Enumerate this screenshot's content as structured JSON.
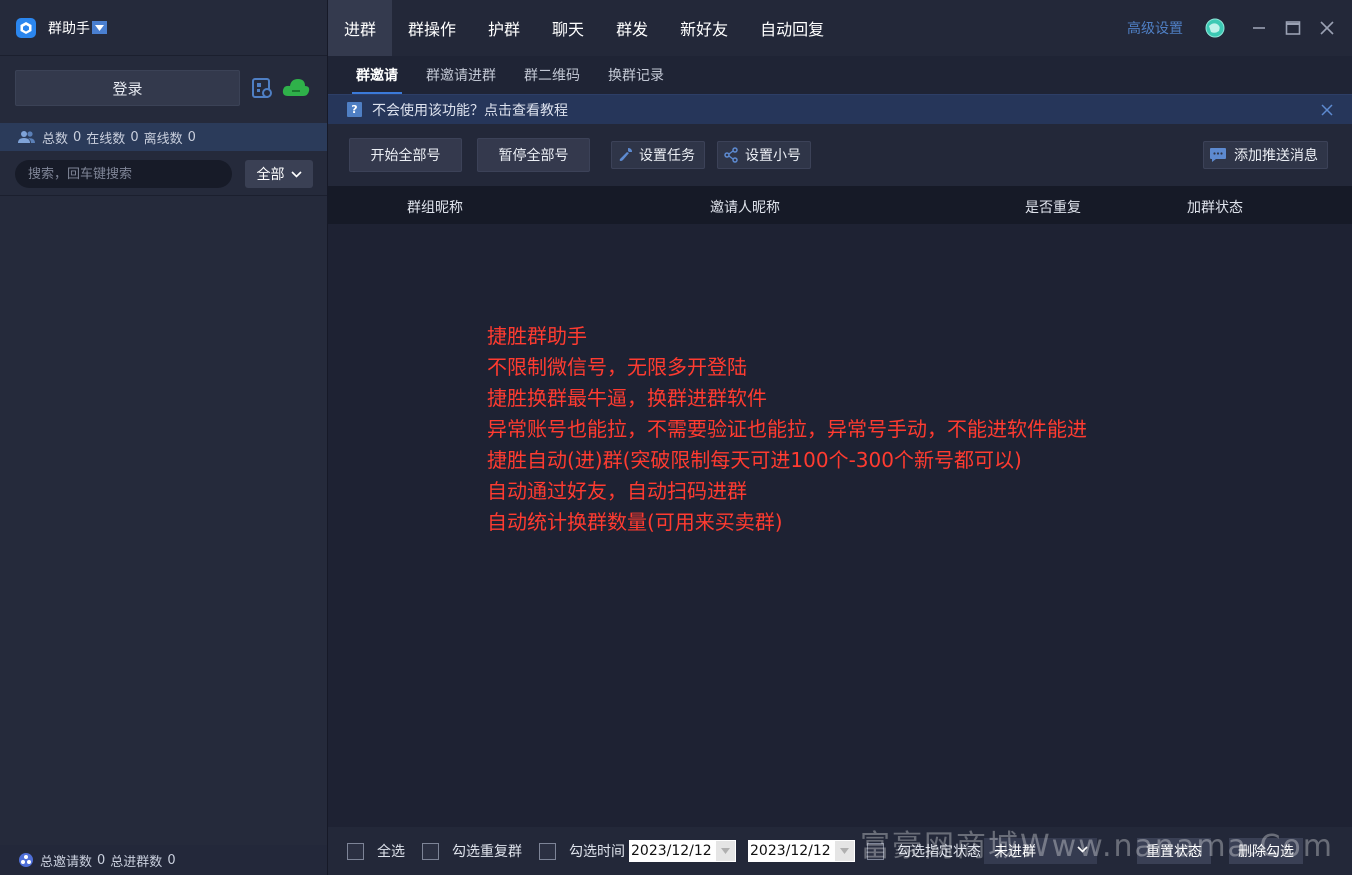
{
  "app": {
    "title": "群助手",
    "logo_icon": "hexagon-logo-icon"
  },
  "sidebar": {
    "login_label": "登录",
    "stats": {
      "total_label": "总数",
      "total": "0",
      "online_label": "在线数",
      "online": "0",
      "offline_label": "离线数",
      "offline": "0"
    },
    "search_placeholder": "搜索，回车键搜索",
    "filter_value": "全部",
    "footer": {
      "invites_label": "总邀请数",
      "invites": "0",
      "joined_label": "总进群数",
      "joined": "0"
    }
  },
  "topnav": {
    "tabs": [
      "进群",
      "群操作",
      "护群",
      "聊天",
      "群发",
      "新好友",
      "自动回复"
    ],
    "active_index": 0,
    "advanced_label": "高级设置"
  },
  "subnav": {
    "tabs": [
      "群邀请",
      "群邀请进群",
      "群二维码",
      "换群记录"
    ],
    "active_index": 0
  },
  "notice": {
    "text": "不会使用该功能？点击查看教程"
  },
  "toolbar": {
    "start_all": "开始全部号",
    "pause_all": "暂停全部号",
    "set_task": "设置任务",
    "set_alt": "设置小号",
    "add_push": "添加推送消息"
  },
  "table": {
    "columns": [
      "群组昵称",
      "邀请人昵称",
      "是否重复",
      "加群状态"
    ]
  },
  "promo_lines": [
    "捷胜群助手",
    "不限制微信号，无限多开登陆",
    "捷胜换群最牛逼，换群进群软件",
    "异常账号也能拉，不需要验证也能拉，异常号手动，不能进软件能进",
    "捷胜自动(进)群(突破限制每天可进100个-300个新号都可以)",
    "自动通过好友，自动扫码进群",
    "自动统计换群数量(可用来买卖群)"
  ],
  "bottombar": {
    "select_all": "全选",
    "select_dup": "勾选重复群",
    "select_time": "勾选时间",
    "date_from": "2023/12/12",
    "date_to": "2023/12/12",
    "select_status": "勾选指定状态",
    "status_value": "未进群",
    "reset_status": "重置状态",
    "delete_selected": "删除勾选"
  },
  "watermark": "富豪网商城Www.nanama.Com",
  "colors": {
    "accent": "#3b7ad9",
    "promo_text": "#ff3b30",
    "link": "#4f7fc4",
    "cloud": "#2fb14a"
  }
}
